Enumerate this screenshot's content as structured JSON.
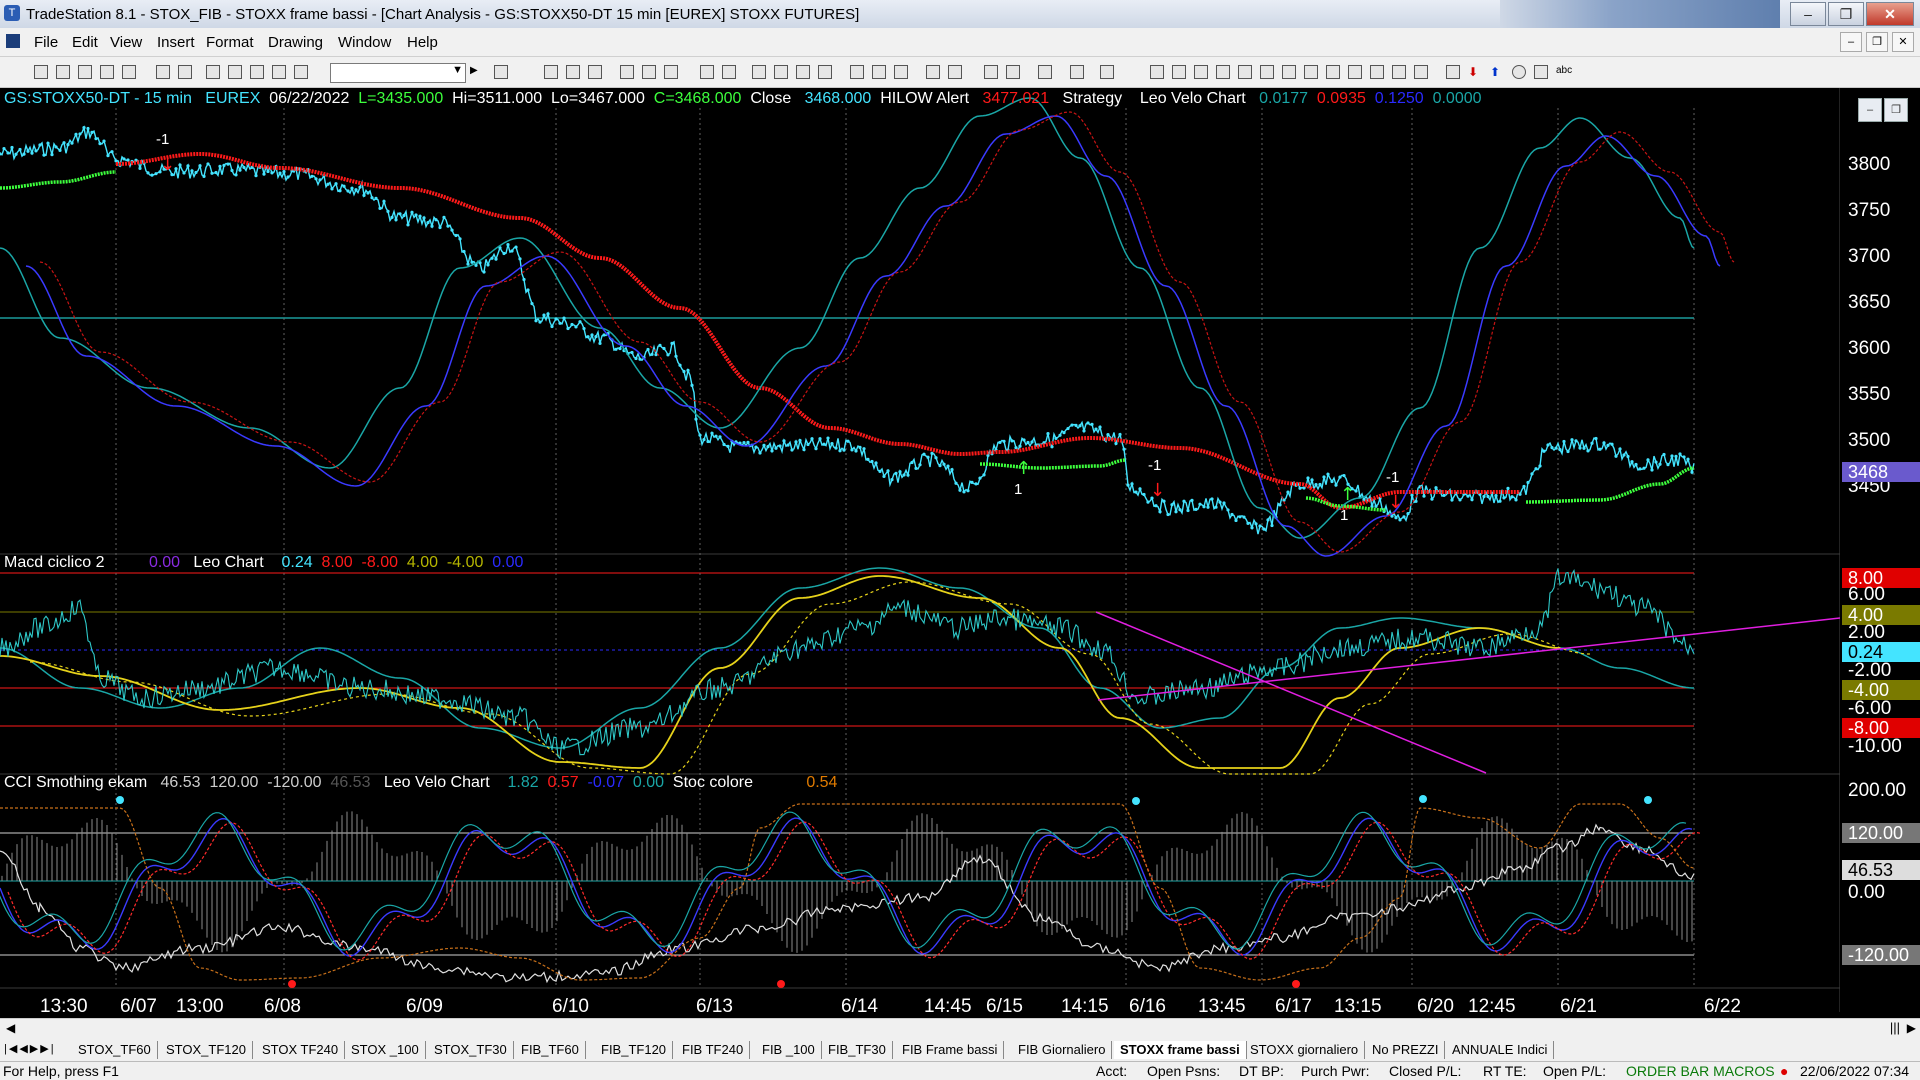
{
  "window": {
    "title": "TradeStation 8.1 - STOX_FIB - STOXX frame bassi - [Chart Analysis - GS:STOXX50-DT  15 min  [EUREX] STOXX FUTURES]",
    "minimize": "–",
    "restore": "❐",
    "close": "✕"
  },
  "menu": [
    "File",
    "Edit",
    "View",
    "Insert",
    "Format",
    "Drawing",
    "Window",
    "Help"
  ],
  "mdi_buttons": [
    "–",
    "❐",
    "✕"
  ],
  "price_header": {
    "symbol": "GS:STOXX50-DT - 15 min",
    "exchange": "EUREX",
    "date": "06/22/2022",
    "last": "L=3435.000",
    "high": "Hi=3511.000",
    "low": "Lo=3467.000",
    "close_c": "C=3468.000",
    "close_word": "Close",
    "close_val": "3468.000",
    "hilow": "HILOW Alert",
    "hilow_val": "3477.021",
    "strategy": "Strategy",
    "leo": "Leo Velo Chart",
    "v1": "0.0177",
    "v2": "0.0935",
    "v3": "0.1250",
    "v4": "0.0000"
  },
  "macd_header": {
    "name": "Macd ciclico 2",
    "v0": "0.00",
    "leo": "Leo Chart",
    "v1": "0.24",
    "v2": "8.00",
    "v3": "-8.00",
    "v4": "4.00",
    "v5": "-4.00",
    "v6": "0.00"
  },
  "cci_header": {
    "name": "CCI Smothing ekam",
    "v1": "46.53",
    "v2": "120.00",
    "v3": "-120.00",
    "v4": "46.53",
    "leo": "Leo Velo Chart",
    "l1": "1.82",
    "l2": "0.57",
    "l3": "-0.07",
    "l4": "0.00",
    "stoc": "Stoc colore",
    "stoc_val": "0.54"
  },
  "price_axis": [
    "3800",
    "3750",
    "3700",
    "3650",
    "3600",
    "3550",
    "3500",
    "3450"
  ],
  "price_tags": {
    "last": "3468"
  },
  "macd_axis": [
    "6.00",
    "2.00",
    "-2.00",
    "-6.00",
    "-10.00"
  ],
  "macd_tags": {
    "plus8": "8.00",
    "plus4": "4.00",
    "cur": "0.24",
    "minus4": "-4.00",
    "minus8": "-8.00"
  },
  "cci_axis": [
    "200.00",
    "0.00"
  ],
  "cci_tags": {
    "plus120": "120.00",
    "cur": "46.53",
    "minus120": "-120.00"
  },
  "annotations": {
    "m1": "-1",
    "p1": "1"
  },
  "x_axis": [
    "13:30",
    "6/07",
    "13:00",
    "6/08",
    "6/09",
    "6/10",
    "6/13",
    "6/14",
    "14:45",
    "6/15",
    "14:15",
    "6/16",
    "13:45",
    "6/17",
    "13:15",
    "6/20",
    "12:45",
    "6/21",
    "6/22"
  ],
  "tabs": [
    "STOX_TF60",
    "STOX_TF120",
    "STOX TF240",
    "STOX _100",
    "STOX_TF30",
    "FIB_TF60",
    "FIB_TF120",
    "FIB TF240",
    "FIB _100",
    "FIB_TF30",
    "FIB Frame bassi",
    "FIB Giornaliero",
    "STOXX frame bassi",
    "STOXX giornaliero",
    "No PREZZI",
    "ANNUALE Indici"
  ],
  "status": {
    "help": "For Help, press F1",
    "acct": "Acct:",
    "psns": "Open Psns:",
    "dtbp": "DT BP:",
    "purch": "Purch Pwr:",
    "closed": "Closed P/L:",
    "rtte": "RT TE:",
    "openpl": "Open P/L:",
    "macros": "ORDER BAR  MACROS",
    "datetime": "22/06/2022 07:34"
  },
  "colors": {
    "cyan": "#44e4ff",
    "red": "#ff1a1a",
    "green": "#3dff3d",
    "teal": "#1aa6a6",
    "navy": "#3a3aff",
    "yellow": "#e6d21a",
    "magenta": "#e01ee0",
    "olive": "#7a7a00"
  }
}
